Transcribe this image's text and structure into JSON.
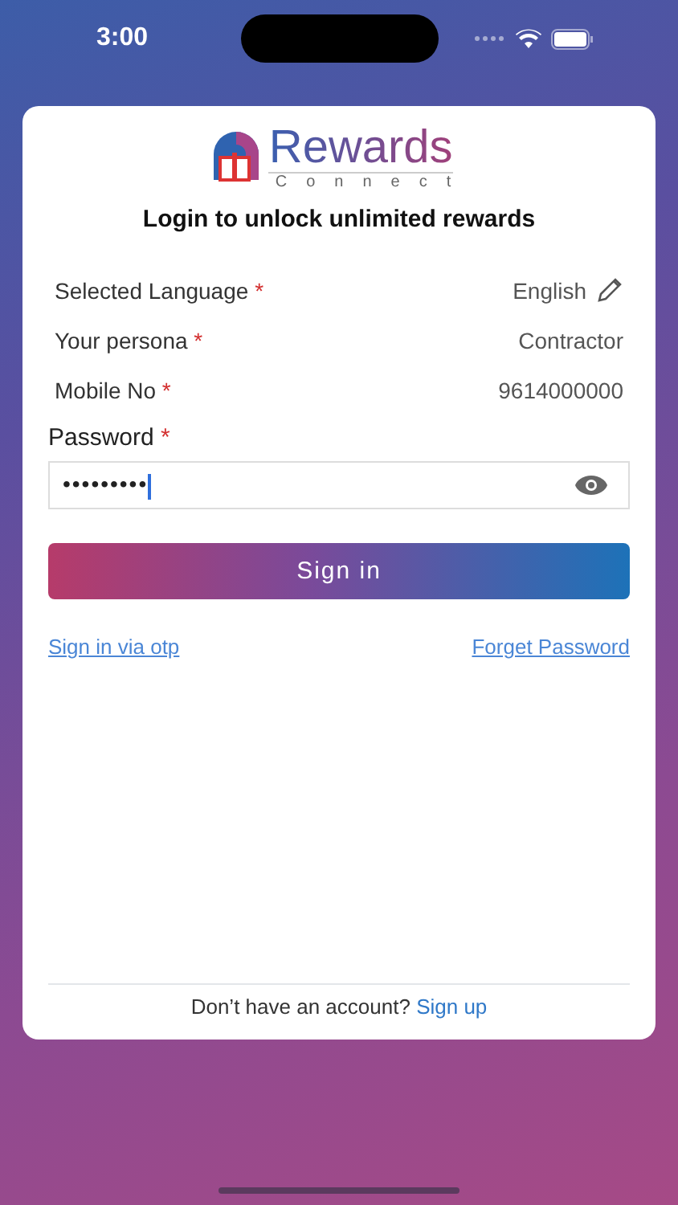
{
  "status_bar": {
    "time": "3:00"
  },
  "logo": {
    "word": "Rewards",
    "sub": "Connect"
  },
  "title": "Login to unlock unlimited rewards",
  "fields": [
    {
      "kind": "editable",
      "label": "Selected Language",
      "mark": "*",
      "value": "English"
    },
    {
      "kind": "display",
      "label": "Your persona",
      "mark": "*",
      "value": "Contractor"
    },
    {
      "kind": "display",
      "label": "Mobile No",
      "mark": "*",
      "value": "9614000000"
    }
  ],
  "password": {
    "label": "Password",
    "mark": "*",
    "value": "•••••••••"
  },
  "sign_in_button": "Sign in",
  "links": [
    "Sign in via otp",
    "Forget Password"
  ],
  "footer": {
    "text": "Don’t have an account?",
    "link": "Sign up"
  }
}
